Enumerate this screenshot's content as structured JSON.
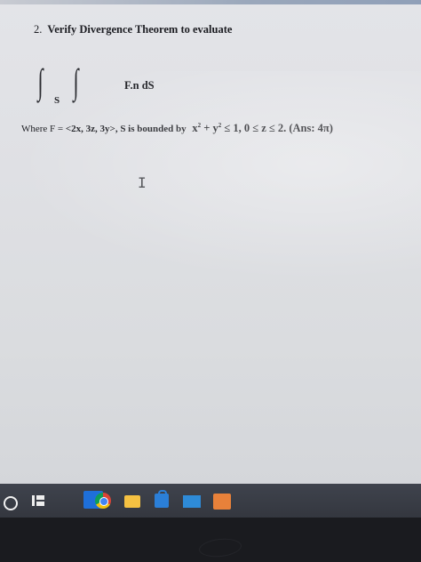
{
  "document": {
    "problem_number": "2.",
    "heading": "Verify Divergence Theorem to evaluate",
    "integral_symbol": "∫",
    "integral_subscript": "S",
    "integrand": "F.n dS",
    "where_prefix": "Where F = ",
    "vector_field": "<2x, 3z, 3y>",
    "surface_phrase": ", S is bounded by",
    "cond_x": "x",
    "cond_plus": " + y",
    "cond_rest": " ≤ 1, 0 ≤ z ≤ 2. (Ans: 4π)",
    "exp2": "2"
  },
  "cursor_glyph": "I",
  "taskbar": {
    "apps": [
      "start-icon",
      "task-view-icon",
      "blue-app-icon",
      "chrome-icon",
      "file-explorer-icon",
      "store-icon",
      "mail-icon",
      "office-icon"
    ]
  },
  "colors": {
    "screen_bg": "#dfe0e4",
    "text": "#1c1d22",
    "taskbar": "#3a3d46"
  }
}
